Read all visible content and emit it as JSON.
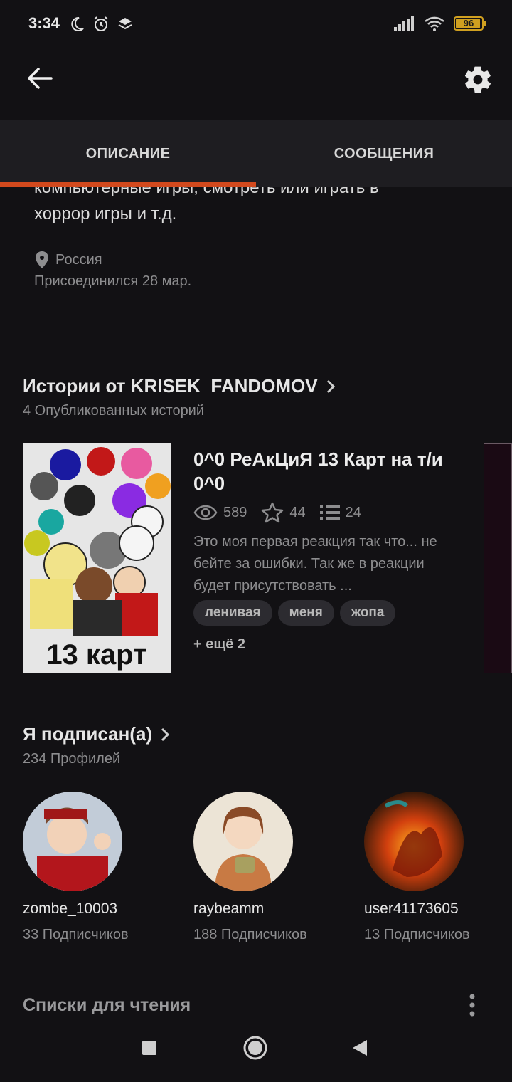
{
  "status_bar": {
    "time": "3:34",
    "battery": "96"
  },
  "tabs": [
    {
      "label": "ОПИСАНИЕ"
    },
    {
      "label": "СООБЩЕНИЯ"
    }
  ],
  "profile": {
    "bio_partial": "компьютерные игры, смотреть или играть в",
    "bio_line": "хоррор игры и т.д.",
    "location": "Россия",
    "joined": "Присоединился 28 мар."
  },
  "stories": {
    "title": "Истории от KRISEK_FANDOMOV",
    "subtitle": "4 Опубликованных историй",
    "items": [
      {
        "cover_text": "13 карт",
        "title": "0^0 РеАкЦиЯ 13 Карт на т/и 0^0",
        "views": "589",
        "votes": "44",
        "parts": "24",
        "description": "Это моя первая реакция так что... не бейте за ошибки. Так же в реакции будет присутствовать ...",
        "tags": [
          "ленивая",
          "меня",
          "жопа"
        ],
        "more_tags": "+ ещё 2"
      }
    ]
  },
  "following": {
    "title": "Я подписан(а)",
    "subtitle": "234 Профилей",
    "users": [
      {
        "name": "zombe_10003",
        "followers": "33 Подписчиков"
      },
      {
        "name": "raybeamm",
        "followers": "188 Подписчиков"
      },
      {
        "name": "user41173605",
        "followers": "13 Подписчиков"
      }
    ]
  },
  "reading_lists": {
    "title": "Списки для чтения"
  },
  "colors": {
    "accent": "#d2491d",
    "background": "#121114",
    "battery": "#d0a020"
  },
  "icons": [
    "back-arrow-icon",
    "gear-icon",
    "location-pin-icon",
    "eye-icon",
    "star-icon",
    "list-icon",
    "chevron-right-icon",
    "kebab-menu-icon",
    "nav-square-icon",
    "nav-circle-icon",
    "nav-back-triangle-icon"
  ]
}
